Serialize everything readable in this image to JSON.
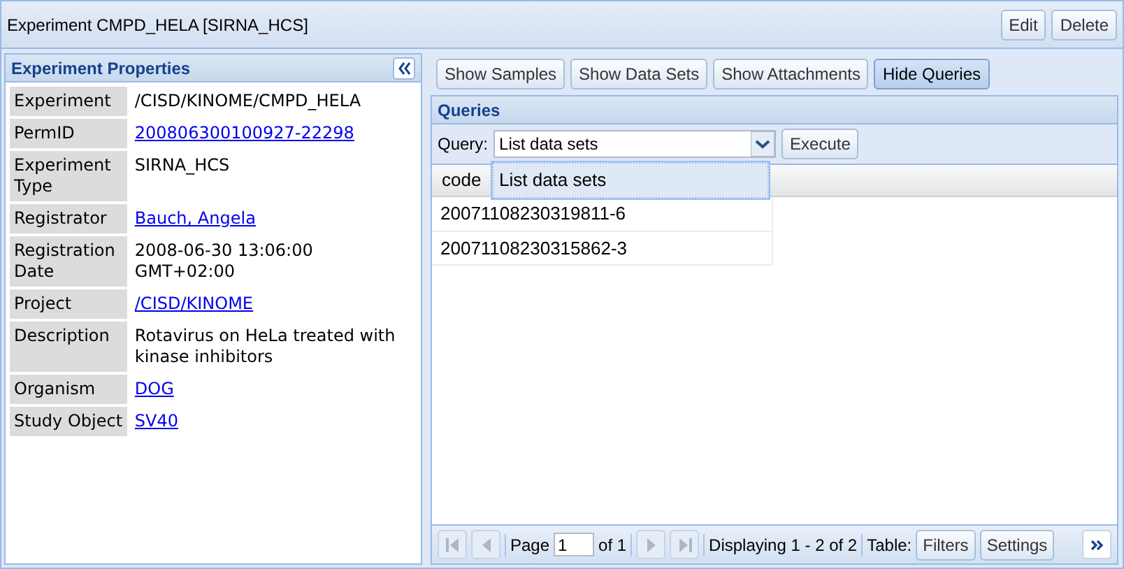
{
  "window": {
    "title": "Experiment CMPD_HELA [SIRNA_HCS]",
    "buttons": [
      "Edit",
      "Delete"
    ]
  },
  "properties_panel": {
    "title": "Experiment Properties",
    "rows": [
      {
        "label": "Experiment",
        "value": "/CISD/KINOME/CMPD_HELA",
        "link": false
      },
      {
        "label": "PermID",
        "value": "200806300100927-22298",
        "link": true
      },
      {
        "label": "Experiment Type",
        "value": "SIRNA_HCS",
        "link": false
      },
      {
        "label": "Registrator",
        "value": "Bauch, Angela",
        "link": true
      },
      {
        "label": "Registration Date",
        "value": "2008-06-30 13:06:00 GMT+02:00",
        "link": false
      },
      {
        "label": "Project",
        "value": "/CISD/KINOME",
        "link": true
      },
      {
        "label": "Description",
        "value": "Rotavirus on HeLa treated with kinase inhibitors",
        "link": false
      },
      {
        "label": "Organism",
        "value": "DOG",
        "link": true
      },
      {
        "label": "Study Object",
        "value": "SV40",
        "link": true
      }
    ]
  },
  "section_buttons": [
    {
      "label": "Show Samples",
      "selected": false
    },
    {
      "label": "Show Data Sets",
      "selected": false
    },
    {
      "label": "Show Attachments",
      "selected": false
    },
    {
      "label": "Hide Queries",
      "selected": true
    }
  ],
  "queries_panel": {
    "title": "Queries",
    "query_label": "Query:",
    "query_value": "List data sets",
    "execute_button": "Execute",
    "dropdown_options": [
      {
        "label": "List data sets",
        "selected": true
      }
    ],
    "columns": [
      "code"
    ],
    "rows": [
      [
        "20071108230319811-6"
      ],
      [
        "20071108230315862-3"
      ]
    ],
    "pager": {
      "nav_disabled": true,
      "page_label": "Page",
      "page_value": "1",
      "page_total": "of 1",
      "display": "Displaying 1 - 2 of 2",
      "table_label": "Table:",
      "buttons": [
        "Filters",
        "Settings"
      ]
    }
  }
}
